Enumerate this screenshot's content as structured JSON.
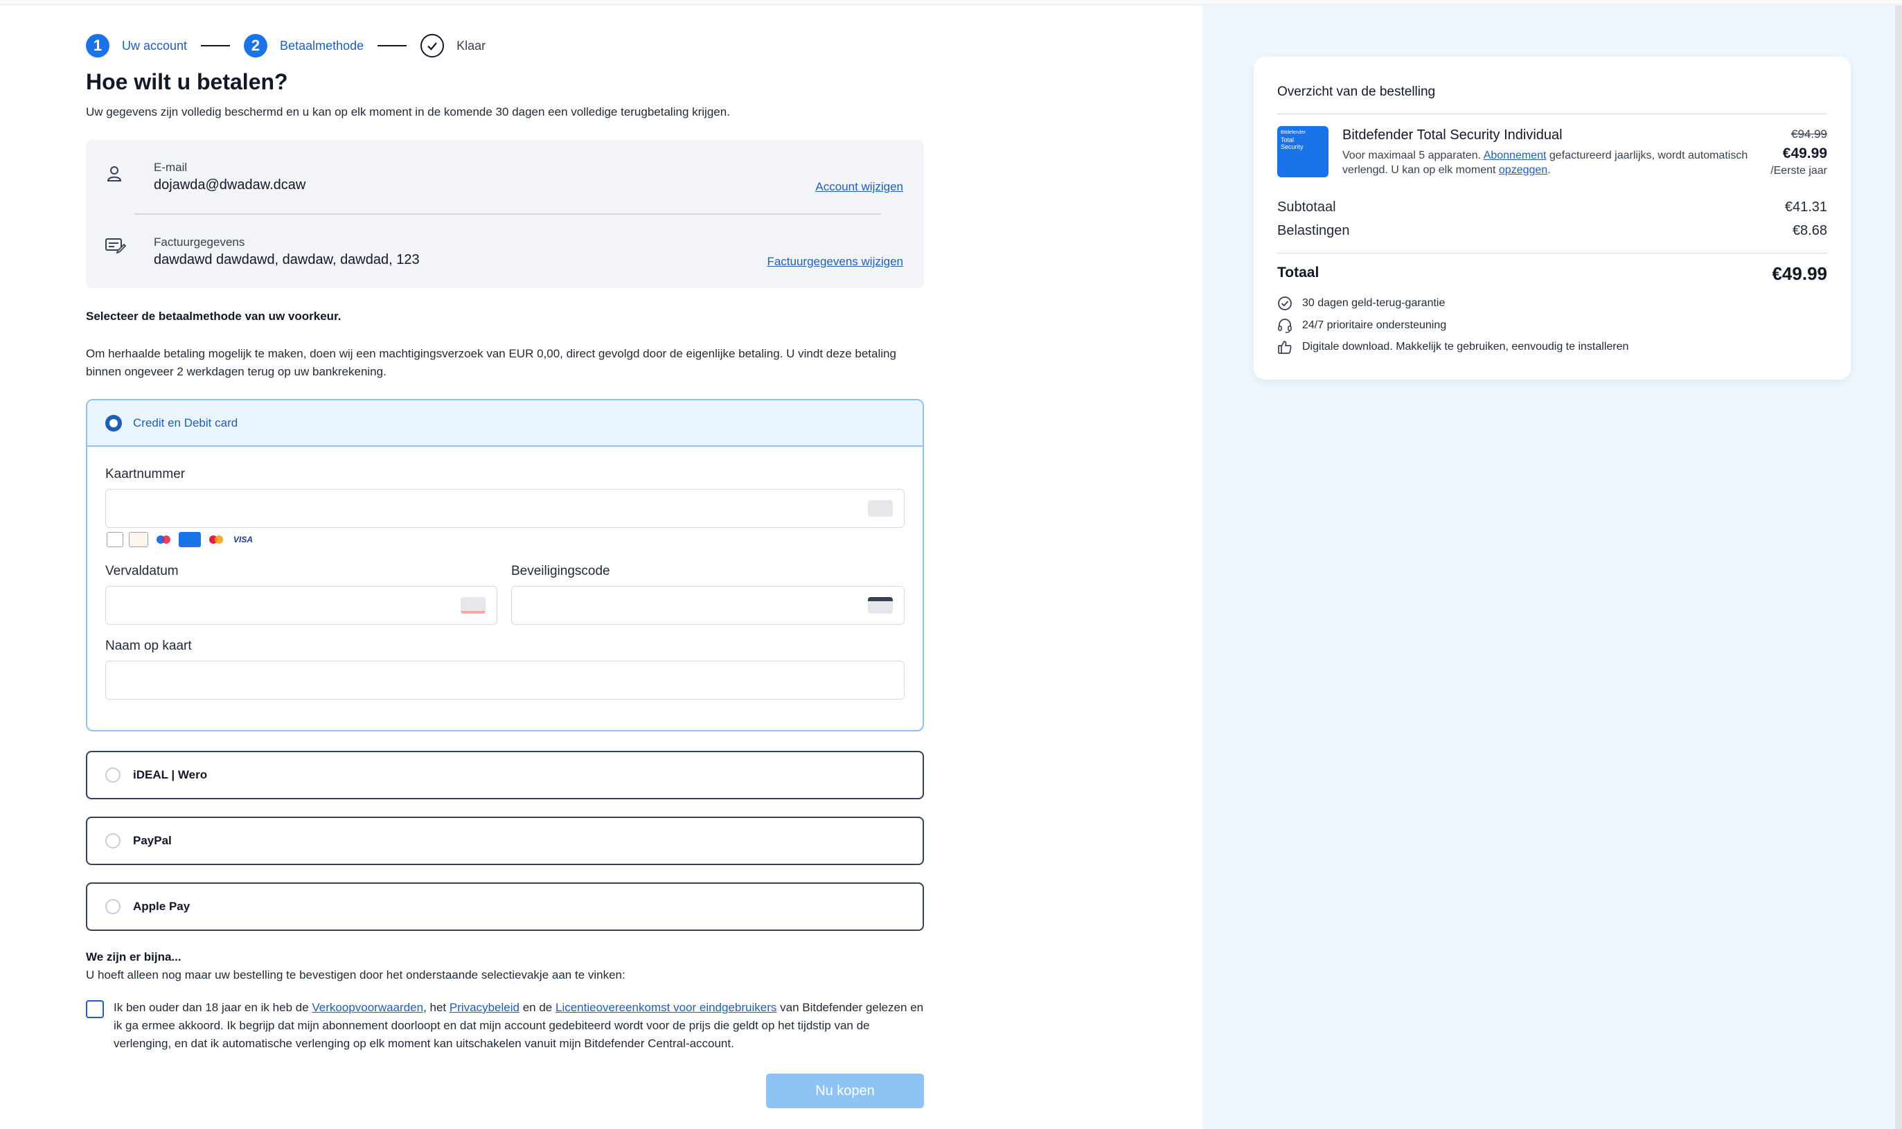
{
  "stepper": {
    "steps": [
      {
        "number": "1",
        "label": "Uw account"
      },
      {
        "number": "2",
        "label": "Betaalmethode"
      },
      {
        "number": "",
        "label": "Klaar"
      }
    ]
  },
  "heading": "Hoe wilt u betalen?",
  "subtitle": "Uw gegevens zijn volledig beschermd en u kan op elk moment in de komende 30 dagen een volledige terugbetaling krijgen.",
  "account": {
    "email_label": "E-mail",
    "email_value": "dojawda@dwadaw.dcaw",
    "email_link": "Account wijzigen",
    "billing_label": "Factuurgegevens",
    "billing_value": "dawdawd dawdawd, dawdaw, dawdad, 123",
    "billing_link": "Factuurgegevens wijzigen"
  },
  "select_title": "Selecteer de betaalmethode van uw voorkeur.",
  "info_text": "Om herhaalde betaling mogelijk te maken, doen wij een machtigingsverzoek van EUR 0,00, direct gevolgd door de eigenlijke betaling. U vindt deze betaling binnen ongeveer 2 werkdagen terug op uw bankrekening.",
  "card_payment": {
    "label": "Credit en Debit card",
    "card_number_label": "Kaartnummer",
    "card_number_value": "",
    "expiry_label": "Vervaldatum",
    "expiry_value": "",
    "cvc_label": "Beveiligingscode",
    "cvc_value": "",
    "name_label": "Naam op kaart",
    "name_value": "",
    "brands": [
      "Diners",
      "Discover",
      "Maestro",
      "AMEX",
      "Mastercard",
      "VISA"
    ]
  },
  "other_methods": [
    {
      "label": "iDEAL | Wero"
    },
    {
      "label": "PayPal"
    },
    {
      "label": "Apple Pay"
    }
  ],
  "confirm": {
    "title": "We zijn er bijna...",
    "subtitle": "U hoeft alleen nog maar uw bestelling te bevestigen door het onderstaande selectievakje aan te vinken:",
    "consent_1": "Ik ben ouder dan 18 jaar en ik heb de ",
    "link_terms": "Verkoopvoorwaarden",
    "consent_2": ", het ",
    "link_privacy": "Privacybeleid",
    "consent_3": " en de ",
    "link_license": "Licentieovereenkomst voor eindgebruikers",
    "consent_4": " van Bitdefender gelezen en ik ga ermee akkoord. Ik begrijp dat mijn abonnement doorloopt en dat mijn account gedebiteerd wordt voor de prijs die geldt op het tijdstip van de verlenging, en dat ik automatische verlenging op elk moment kan uitschakelen vanuit mijn Bitdefender Central-account.",
    "buy_label": "Nu kopen"
  },
  "summary": {
    "title": "Overzicht van de bestelling",
    "product_image_text": [
      "Bitdefender",
      "Total",
      "Security"
    ],
    "product_name": "Bitdefender Total Security Individual",
    "product_desc_1": "Voor maximaal 5 apparaten. ",
    "product_desc_link1": "Abonnement",
    "product_desc_2": " gefactureerd jaarlijks, wordt automatisch verlengd. U kan op elk moment ",
    "product_desc_link2": "opzeggen",
    "product_desc_3": ".",
    "price_old": "€94.99",
    "price_new": "€49.99",
    "price_period": "/Eerste jaar",
    "subtotal_label": "Subtotaal",
    "subtotal_value": "€41.31",
    "tax_label": "Belastingen",
    "tax_value": "€8.68",
    "total_label": "Totaal",
    "total_value": "€49.99",
    "features": [
      {
        "icon": "check-circle-icon",
        "text": "30 dagen geld-terug-garantie"
      },
      {
        "icon": "headset-icon",
        "text": "24/7 prioritaire ondersteuning"
      },
      {
        "icon": "thumbs-up-icon",
        "text": "Digitale download. Makkelijk te gebruiken, eenvoudig te installeren"
      }
    ]
  },
  "colors": {
    "accent": "#1a73e8",
    "link": "#1d5fb8",
    "panel_bg": "#eef6fe",
    "buy_button": "#8fc3f5"
  }
}
